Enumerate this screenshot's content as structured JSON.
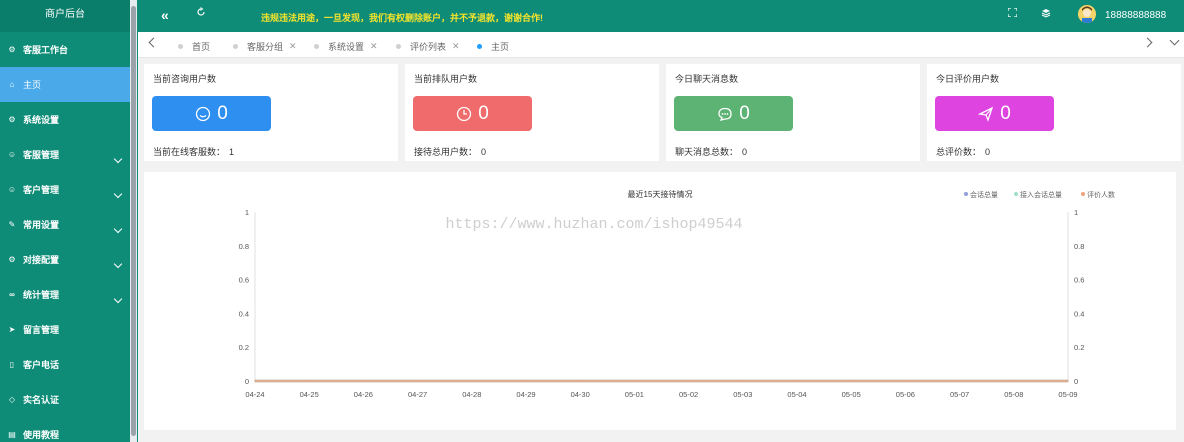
{
  "sidebar": {
    "logo": "商户后台",
    "items": [
      {
        "label": "客服工作台",
        "icon": "settings-icon"
      },
      {
        "label": "主页",
        "icon": "home-icon",
        "active": true
      },
      {
        "label": "系统设置",
        "icon": "gear-icon"
      },
      {
        "label": "客服管理",
        "icon": "user-icon",
        "expandable": true
      },
      {
        "label": "客户管理",
        "icon": "customers-icon",
        "expandable": true
      },
      {
        "label": "常用设置",
        "icon": "edit-icon",
        "expandable": true
      },
      {
        "label": "对接配置",
        "icon": "settings-icon",
        "expandable": true
      },
      {
        "label": "统计管理",
        "icon": "chain-icon",
        "expandable": true
      },
      {
        "label": "留言管理",
        "icon": "send-icon"
      },
      {
        "label": "客户电话",
        "icon": "phone-icon"
      },
      {
        "label": "实名认证",
        "icon": "shield-icon"
      },
      {
        "label": "使用教程",
        "icon": "book-icon"
      }
    ]
  },
  "topbar": {
    "notice": "违规违法用途，一旦发现，我们有权删除账户，并不予退款，谢谢合作!",
    "username": "18888888888"
  },
  "tabs": [
    {
      "label": "首页",
      "closable": false
    },
    {
      "label": "客服分组",
      "closable": true
    },
    {
      "label": "系统设置",
      "closable": true
    },
    {
      "label": "评价列表",
      "closable": true
    },
    {
      "label": "主页",
      "closable": false,
      "active": true
    }
  ],
  "cards": [
    {
      "title": "当前咨询用户数",
      "value": "0",
      "color": "#2e8ff0",
      "icon": "smile-icon",
      "foot_label": "当前在线客服数：",
      "foot_value": "1"
    },
    {
      "title": "当前排队用户数",
      "value": "0",
      "color": "#f06b6b",
      "icon": "clock-icon",
      "foot_label": "接待总用户数：",
      "foot_value": "0"
    },
    {
      "title": "今日聊天消息数",
      "value": "0",
      "color": "#5cb374",
      "icon": "chat-icon",
      "foot_label": "聊天消息总数：",
      "foot_value": "0"
    },
    {
      "title": "今日评价用户数",
      "value": "0",
      "color": "#dd44e0",
      "icon": "send-icon",
      "foot_label": "总评价数：",
      "foot_value": "0"
    }
  ],
  "watermark": "https://www.huzhan.com/ishop49544",
  "chart_data": {
    "type": "line",
    "title": "最近15天接待情况",
    "x": [
      "04-24",
      "04-25",
      "04-26",
      "04-27",
      "04-28",
      "04-29",
      "04-30",
      "05-01",
      "05-02",
      "05-03",
      "05-04",
      "05-05",
      "05-06",
      "05-07",
      "05-08",
      "05-09"
    ],
    "series": [
      {
        "name": "会话总量",
        "color": "#91a0d6",
        "values": [
          0,
          0,
          0,
          0,
          0,
          0,
          0,
          0,
          0,
          0,
          0,
          0,
          0,
          0,
          0,
          0
        ]
      },
      {
        "name": "接入会话总量",
        "color": "#9ee0c6",
        "values": [
          0,
          0,
          0,
          0,
          0,
          0,
          0,
          0,
          0,
          0,
          0,
          0,
          0,
          0,
          0,
          0
        ]
      },
      {
        "name": "评价人数",
        "color": "#f0a27a",
        "values": [
          0,
          0,
          0,
          0,
          0,
          0,
          0,
          0,
          0,
          0,
          0,
          0,
          0,
          0,
          0,
          0
        ]
      }
    ],
    "y_ticks": [
      "0",
      "0.2",
      "0.4",
      "0.6",
      "0.8",
      "1"
    ],
    "ylim": [
      0,
      1
    ],
    "legend_position": "top-right",
    "grid": false
  }
}
